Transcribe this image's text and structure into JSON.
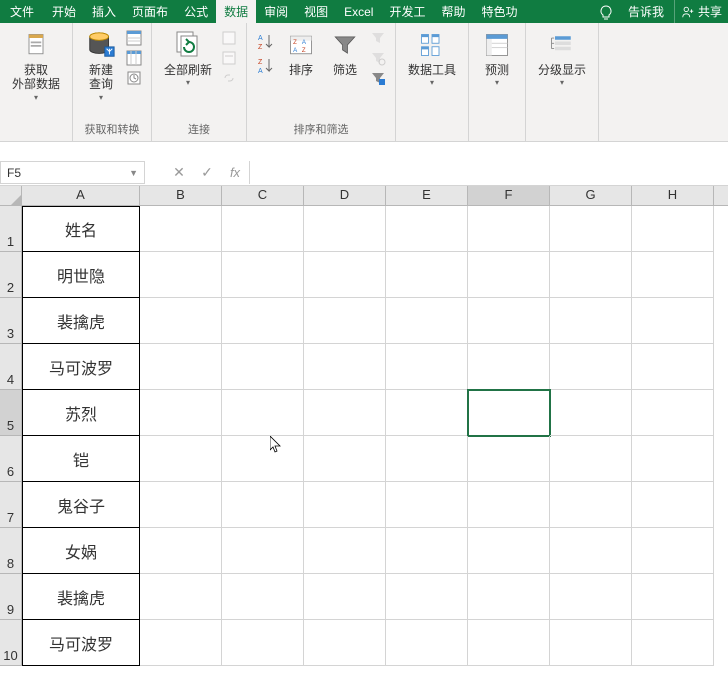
{
  "tabs": {
    "file": "文件",
    "home": "开始",
    "insert": "插入",
    "pagelayout": "页面布",
    "formulas": "公式",
    "data": "数据",
    "review": "审阅",
    "view": "视图",
    "excel": "Excel",
    "developer": "开发工",
    "help": "帮助",
    "special": "特色功"
  },
  "titlebar": {
    "tell_me": "告诉我",
    "share": "共享"
  },
  "ribbon": {
    "get_external": "获取\n外部数据",
    "new_query": "新建\n查询",
    "group_get_transform": "获取和转换",
    "refresh_all": "全部刷新",
    "group_connections": "连接",
    "sort": "排序",
    "filter": "筛选",
    "group_sort_filter": "排序和筛选",
    "data_tools": "数据工具",
    "forecast": "预测",
    "outline": "分级显示"
  },
  "formula_bar": {
    "name_box": "F5",
    "formula": ""
  },
  "columns": [
    "A",
    "B",
    "C",
    "D",
    "E",
    "F",
    "G",
    "H"
  ],
  "rows": [
    {
      "num": "1",
      "a": "姓名"
    },
    {
      "num": "2",
      "a": "明世隐"
    },
    {
      "num": "3",
      "a": "裴擒虎"
    },
    {
      "num": "4",
      "a": "马可波罗"
    },
    {
      "num": "5",
      "a": "苏烈"
    },
    {
      "num": "6",
      "a": "铠"
    },
    {
      "num": "7",
      "a": "鬼谷子"
    },
    {
      "num": "8",
      "a": "女娲"
    },
    {
      "num": "9",
      "a": "裴擒虎"
    },
    {
      "num": "10",
      "a": "马可波罗"
    }
  ],
  "selected_cell": {
    "row": 5,
    "col": "F"
  }
}
